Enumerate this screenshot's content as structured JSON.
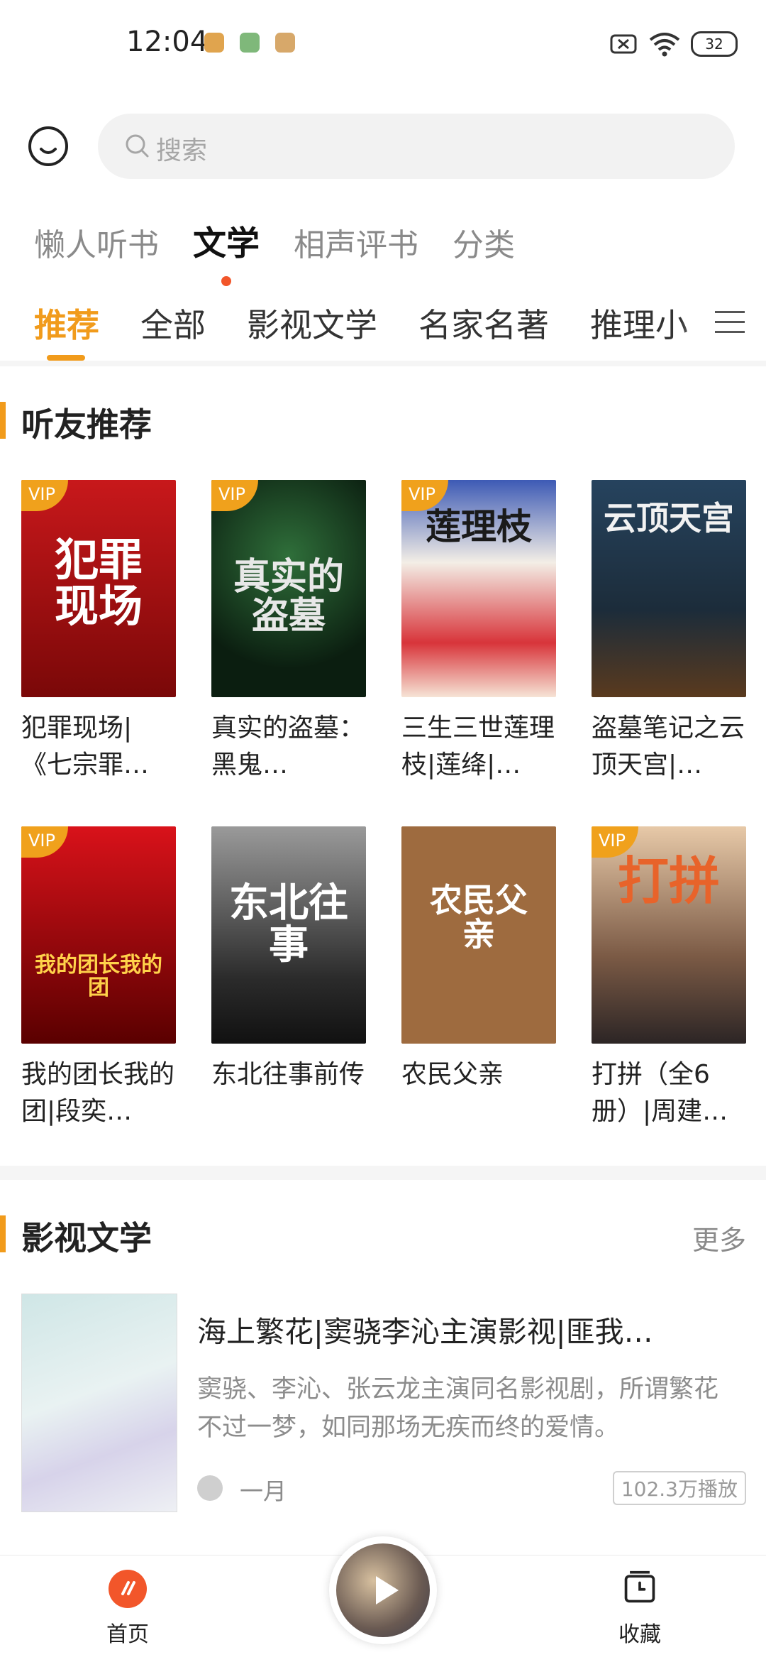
{
  "status_bar": {
    "time": "12:04",
    "battery": "32"
  },
  "search": {
    "placeholder": "搜索"
  },
  "top_tabs": [
    "懒人听书",
    "文学",
    "相声评书",
    "分类"
  ],
  "category_tabs": [
    "推荐",
    "全部",
    "影视文学",
    "名家名著",
    "推理小"
  ],
  "section1": {
    "title": "听友推荐",
    "books": [
      {
        "title": "犯罪现场|《七宗罪…",
        "vip": "VIP",
        "cover_text": "犯罪现场"
      },
      {
        "title": "真实的盗墓：黑鬼…",
        "vip": "VIP",
        "cover_text": "真实的盗墓"
      },
      {
        "title": "三生三世莲理枝|莲绛|…",
        "vip": "VIP",
        "cover_text": "莲理枝"
      },
      {
        "title": "盗墓笔记之云顶天宫|…",
        "vip": "",
        "cover_text": "云顶天宫"
      },
      {
        "title": "我的团长我的团|段奕…",
        "vip": "VIP",
        "cover_text": "我的团长我的团"
      },
      {
        "title": "东北往事前传",
        "vip": "",
        "cover_text": "东北往事"
      },
      {
        "title": "农民父亲",
        "vip": "",
        "cover_text": "农民父亲"
      },
      {
        "title": "打拼（全6册）|周建…",
        "vip": "VIP",
        "cover_text": "打拼"
      }
    ]
  },
  "section2": {
    "title": "影视文学",
    "more": "更多",
    "item": {
      "title": "海上繁花|窦骁李沁主演影视|匪我…",
      "desc": "窦骁、李沁、张云龙主演同名影视剧，所谓繁花不过一梦，如同那场无疾而终的爱情。",
      "author": "一月",
      "plays": "102.3万播放"
    }
  },
  "bottom_nav": {
    "home": "首页",
    "favorites": "收藏"
  },
  "colors": {
    "accent": "#f19b1b",
    "home_icon": "#f2562a"
  }
}
